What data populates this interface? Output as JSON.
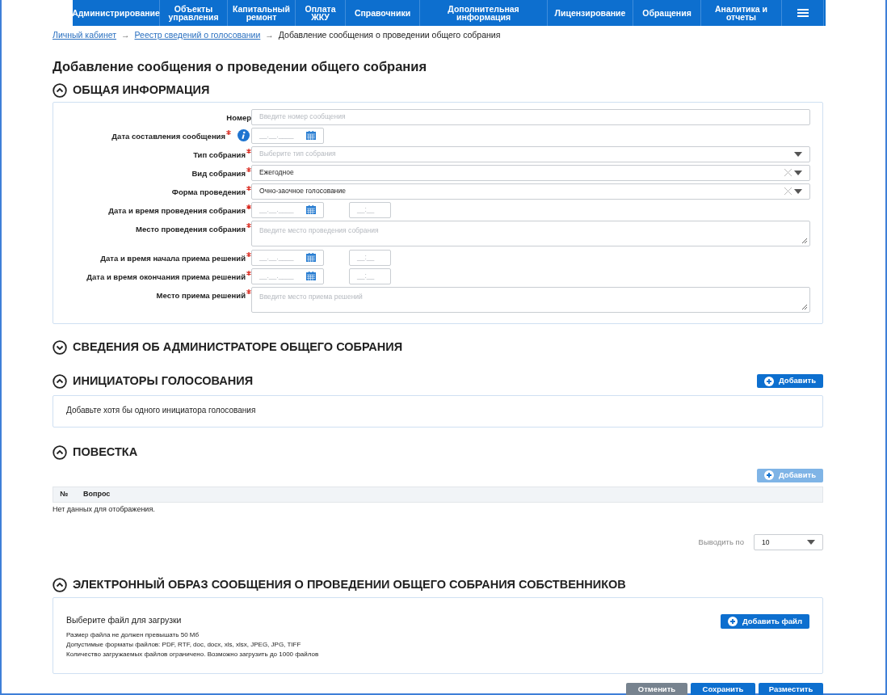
{
  "nav": {
    "items": [
      {
        "label": "Администрирование"
      },
      {
        "label": "Объекты управления"
      },
      {
        "label": "Капитальный ремонт"
      },
      {
        "label": "Оплата ЖКУ"
      },
      {
        "label": "Справочники"
      },
      {
        "label": "Дополнительная информация"
      },
      {
        "label": "Лицензирование"
      },
      {
        "label": "Обращения"
      },
      {
        "label": "Аналитика и отчеты"
      }
    ]
  },
  "breadcrumb": [
    {
      "kind": "link",
      "label": "Личный кабинет"
    },
    {
      "kind": "separator",
      "label": "→"
    },
    {
      "kind": "link",
      "label": "Реестр сведений о голосовании"
    },
    {
      "kind": "separator",
      "label": "→"
    },
    {
      "kind": "current",
      "label": "Добавление сообщения о проведении общего собрания"
    }
  ],
  "page_title": "Добавление сообщения о проведении общего собрания",
  "general": {
    "title": "ОБЩАЯ ИНФОРМАЦИЯ",
    "expanded": true,
    "fields": [
      {
        "kind": "text",
        "label": "Номер",
        "required": false,
        "placeholder": "Введите номер сообщения"
      },
      {
        "kind": "date",
        "label": "Дата составления сообщения",
        "required": true,
        "info": true,
        "placeholder": "__.__.____"
      },
      {
        "kind": "select",
        "label": "Тип собрания",
        "required": true,
        "placeholder": "Выберите тип собрания",
        "clearable": false
      },
      {
        "kind": "select",
        "label": "Вид собрания",
        "required": true,
        "value": "Ежегодное",
        "clearable": true
      },
      {
        "kind": "select",
        "label": "Форма проведения",
        "required": true,
        "value": "Очно-заочное голосование",
        "clearable": true
      },
      {
        "kind": "datetime",
        "label": "Дата и время проведения собрания",
        "required": true,
        "placeholder": "__.__.____",
        "time_placeholder": "__:__"
      },
      {
        "kind": "textarea",
        "label": "Место проведения собрания",
        "required": true,
        "placeholder": "Введите место проведения собрания"
      },
      {
        "kind": "datetime",
        "label": "Дата и время начала приема решений",
        "required": true,
        "placeholder": "__.__.____",
        "time_placeholder": "__:__"
      },
      {
        "kind": "datetime",
        "label": "Дата и время окончания приема решений",
        "required": true,
        "placeholder": "__.__.____",
        "time_placeholder": "__:__"
      },
      {
        "kind": "textarea",
        "label": "Место приема решений",
        "required": true,
        "placeholder": "Введите место приема решений"
      }
    ]
  },
  "administrator": {
    "title": "СВЕДЕНИЯ ОБ АДМИНИСТРАТОРЕ ОБЩЕГО СОБРАНИЯ",
    "expanded": false
  },
  "initiators": {
    "title": "ИНИЦИАТОРЫ ГОЛОСОВАНИЯ",
    "expanded": true,
    "add_button": {
      "label": "Добавить",
      "disabled": false
    },
    "message": "Добавьте хотя бы одного инициатора голосования"
  },
  "agenda": {
    "title": "ПОВЕСТКА",
    "expanded": true,
    "add_button": {
      "label": "Добавить",
      "disabled": true
    },
    "table": {
      "columns": [
        "№",
        "Вопрос"
      ],
      "empty": "Нет данных для отображения."
    },
    "page_size": {
      "label": "Выводить по",
      "value": "10"
    }
  },
  "attachment": {
    "title": "ЭЛЕКТРОННЫЙ ОБРАЗ СООБЩЕНИЯ О ПРОВЕДЕНИИ ОБЩЕГО СОБРАНИЯ СОБСТВЕННИКОВ",
    "expanded": true,
    "heading": "Выберите файл для загрузки",
    "notes": [
      "Размер файла не должен превышать 50 Мб",
      "Допустимые форматы файлов: PDF, RTF, doc, docx, xls, xlsx, JPEG, JPG, TIFF",
      "Количество загружаемых файлов ограничено. Возможно загрузить до 1000 файлов"
    ],
    "button": "Добавить файл"
  },
  "actions": [
    {
      "kind": "secondary",
      "label": "Отменить"
    },
    {
      "kind": "primary",
      "label": "Сохранить"
    },
    {
      "kind": "primary",
      "label": "Разместить"
    }
  ]
}
